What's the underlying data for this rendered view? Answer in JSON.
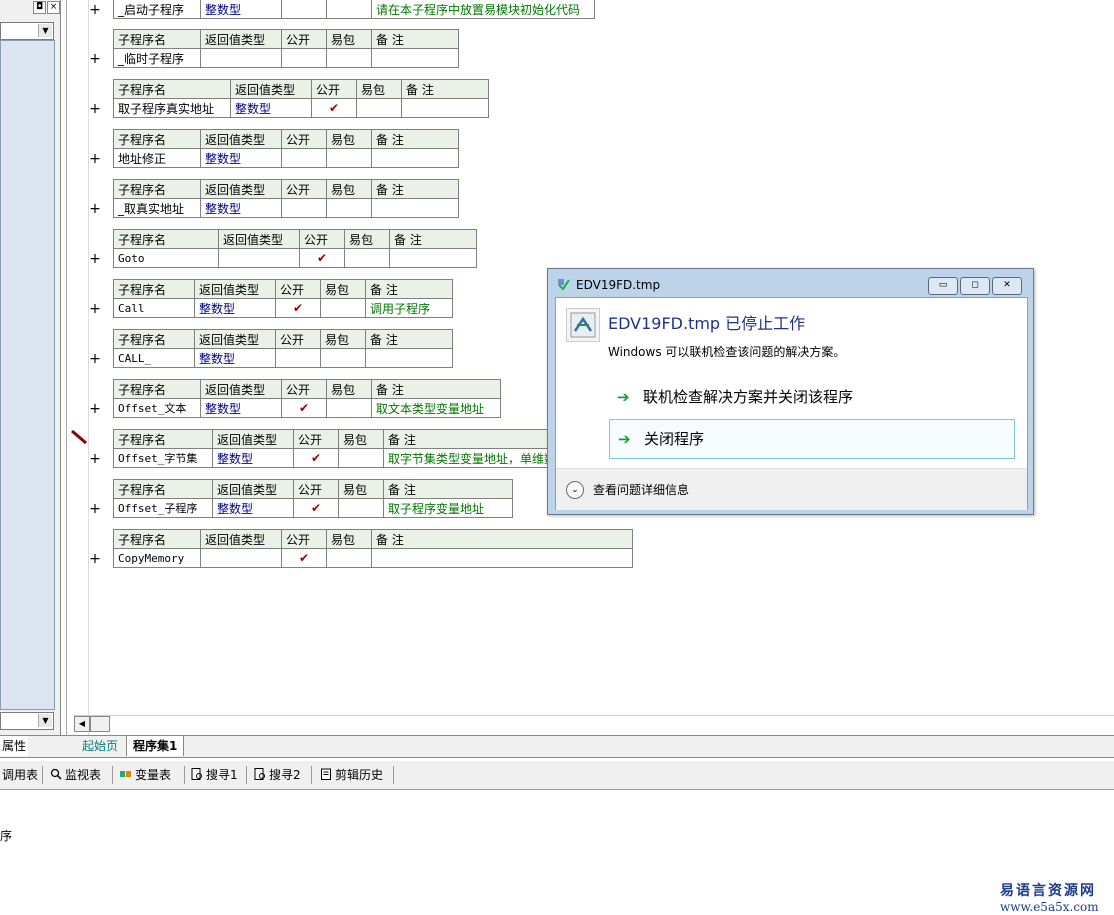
{
  "left_panel": {
    "restore_glyph": "◘",
    "close_glyph": "×",
    "attr_tab": "属性"
  },
  "headers": {
    "name": "子程序名",
    "ret": "返回值类型",
    "pub": "公开",
    "pkg": "易包",
    "note": "备 注"
  },
  "check_glyph": "✔",
  "plus_glyph": "+",
  "subs": [
    {
      "name": "_启动子程序",
      "ret": "整数型",
      "pub": false,
      "note": "请在本子程序中放置易模块初始化代码",
      "mono": false
    },
    {
      "name": "_临时子程序",
      "ret": "",
      "pub": false,
      "note": "",
      "mono": false
    },
    {
      "name": "取子程序真实地址",
      "ret": "整数型",
      "pub": true,
      "note": "",
      "mono": false
    },
    {
      "name": "地址修正",
      "ret": "整数型",
      "pub": false,
      "note": "",
      "mono": false
    },
    {
      "name": "_取真实地址",
      "ret": "整数型",
      "pub": false,
      "note": "",
      "mono": false
    },
    {
      "name": "Goto",
      "ret": "",
      "pub": true,
      "note": "",
      "mono": true
    },
    {
      "name": "Call",
      "ret": "整数型",
      "pub": true,
      "note": "调用子程序",
      "mono": true
    },
    {
      "name": "CALL_",
      "ret": "整数型",
      "pub": false,
      "note": "",
      "mono": true
    },
    {
      "name": "Offset_文本",
      "ret": "整数型",
      "pub": true,
      "note": "取文本类型变量地址",
      "mono": true
    },
    {
      "name": "Offset_字节集",
      "ret": "整数型",
      "pub": true,
      "note": "取字节集类型变量地址，单维数组也可",
      "mono": true
    },
    {
      "name": "Offset_子程序",
      "ret": "整数型",
      "pub": true,
      "note": "取子程序变量地址",
      "mono": true
    },
    {
      "name": "CopyMemory",
      "ret": "",
      "pub": true,
      "note": "",
      "mono": true
    }
  ],
  "tabs": {
    "start": "起始页",
    "set": "程序集1"
  },
  "toolbar": {
    "items": [
      "调用表",
      "监视表",
      "变量表",
      "搜寻1",
      "搜寻2",
      "剪辑历史"
    ]
  },
  "output": {
    "text": "序"
  },
  "watermark": {
    "line1": "易语言资源网",
    "line2": "www.e5a5x.com"
  },
  "dialog": {
    "title": "EDV19FD.tmp",
    "heading": "EDV19FD.tmp 已停止工作",
    "description": "Windows 可以联机检查该问题的解决方案。",
    "option1": "联机检查解决方案并关闭该程序",
    "option2": "关闭程序",
    "details": "查看问题详细信息",
    "arrow_glyph": "➔",
    "expand_glyph": "⌄",
    "minimize_glyph": "▭",
    "maximize_glyph": "◻",
    "close_glyph": "✕"
  },
  "colors": {
    "header_bg": "#eaf1e6",
    "type_blue": "#000080",
    "note_green": "#007700",
    "check_red": "#a00000",
    "dialog_frame": "#bcd3ea"
  }
}
